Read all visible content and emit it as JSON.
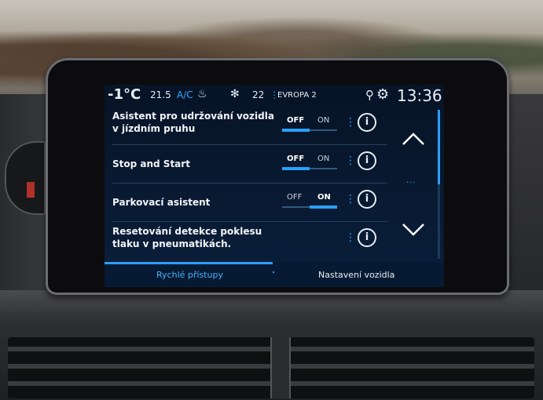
{
  "status": {
    "outside_temp": "-1°C",
    "cabin_temp": "21.5",
    "ac_label": "A/C",
    "fan_level": "22",
    "radio_station": "EVROPA 2",
    "clock": "13:36"
  },
  "settings": [
    {
      "label": "Asistent pro udržování vozidla v jízdním pruhu",
      "off": "OFF",
      "on": "ON",
      "state": "OFF"
    },
    {
      "label": "Stop and Start",
      "off": "OFF",
      "on": "ON",
      "state": "OFF"
    },
    {
      "label": "Parkovací asistent",
      "off": "OFF",
      "on": "ON",
      "state": "ON"
    },
    {
      "label": "Resetování detekce poklesu tlaku v pneumatikách.",
      "info": "i"
    }
  ],
  "info_glyph": "i",
  "tabs": {
    "quick_access": "Rychlé přístupy",
    "vehicle_settings": "Nastavení vozidla"
  },
  "scroll_fraction": 0.5,
  "icons": [
    "seat-heat-icon",
    "fan-icon",
    "location-pin-icon",
    "gear-icon",
    "chevron-up-icon",
    "chevron-down-icon",
    "info-icon"
  ],
  "colors": {
    "accent": "#2aa0ff",
    "screen": "#0a1f3b"
  }
}
